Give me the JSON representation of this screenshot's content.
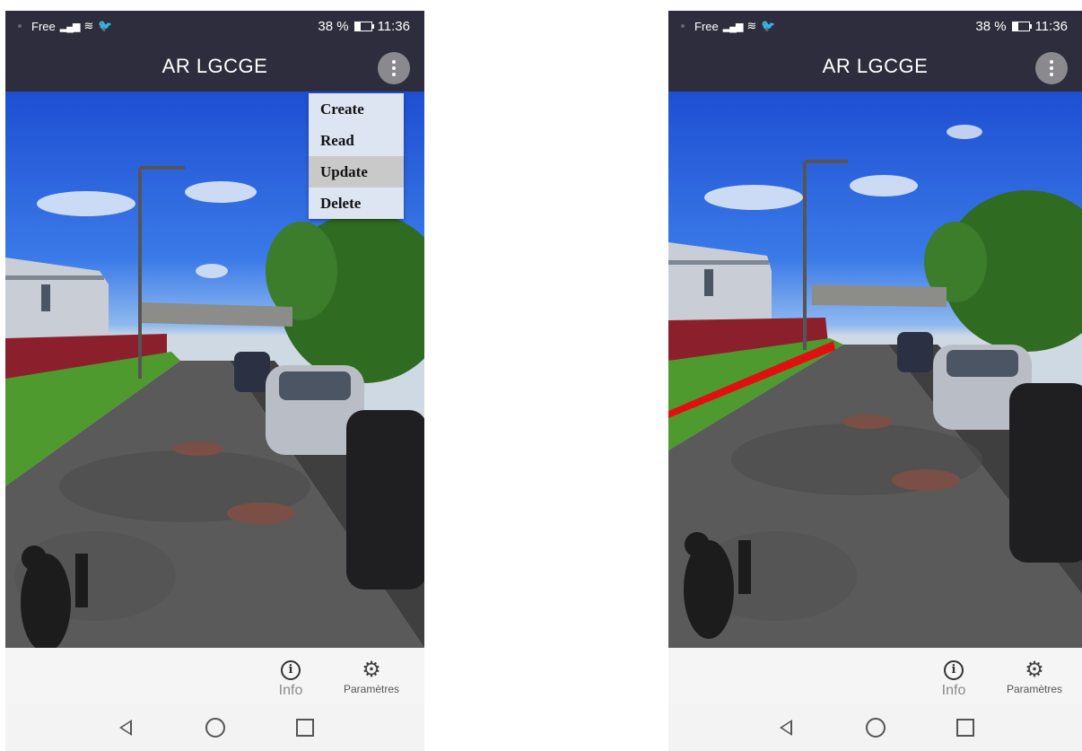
{
  "screens": [
    {
      "status": {
        "carrier": "Free",
        "battery": "38 %",
        "time": "11:36"
      },
      "app_title": "AR LGCGE",
      "menu": [
        "Create",
        "Read",
        "Update",
        "Delete"
      ],
      "menu_highlighted": "Update",
      "nav": {
        "info": "Info",
        "settings": "Paramètres"
      }
    },
    {
      "status": {
        "carrier": "Free",
        "battery": "38 %",
        "time": "11:36"
      },
      "app_title": "AR LGCGE",
      "nav": {
        "info": "Info",
        "settings": "Paramètres"
      },
      "overlay": {
        "type": "ar-line",
        "color": "#e01010"
      }
    }
  ],
  "colors": {
    "appbar": "#2d2d3d",
    "menu_bg": "#dde4f2",
    "menu_highlight": "#c9c9c9"
  },
  "icons": [
    "info-icon",
    "gear-icon",
    "back-icon",
    "home-icon",
    "recents-icon",
    "overflow-menu-icon"
  ]
}
